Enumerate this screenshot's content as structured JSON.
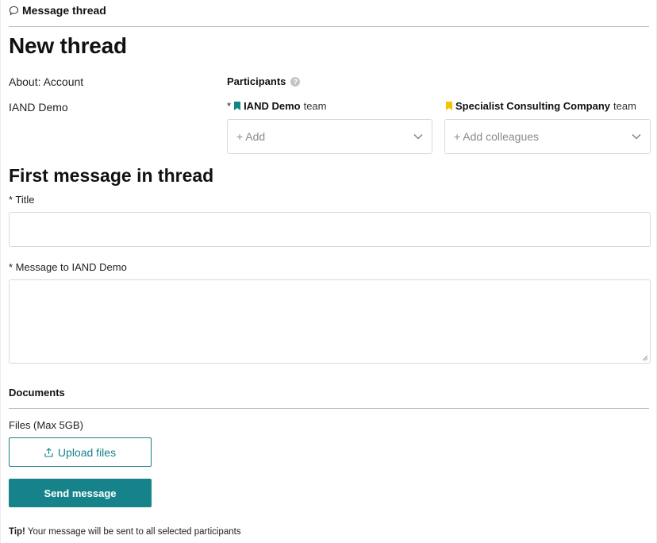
{
  "header": {
    "title": "Message thread",
    "icon": "speech-bubble-icon"
  },
  "page": {
    "heading": "New thread"
  },
  "about": {
    "label": "About: Account",
    "name": "IAND Demo"
  },
  "participants": {
    "label": "Participants",
    "teams": [
      {
        "required": "*",
        "name": "IAND Demo",
        "suffix": "team",
        "flag_color": "#14838a",
        "placeholder": "+ Add"
      },
      {
        "required": "",
        "name": "Specialist Consulting Company",
        "suffix": "team",
        "flag_color": "#f5c400",
        "placeholder": "+ Add colleagues"
      }
    ]
  },
  "first_message": {
    "heading": "First message in thread",
    "title_label": "* Title",
    "title_value": "",
    "message_label": "* Message to IAND Demo",
    "message_value": ""
  },
  "documents": {
    "heading": "Documents",
    "files_label": "Files (Max 5GB)",
    "upload_label": "Upload files"
  },
  "actions": {
    "send_label": "Send message"
  },
  "tip": {
    "prefix": "Tip!",
    "text": "Your message will be sent to all selected participants"
  },
  "colors": {
    "accent": "#16838a",
    "border": "#d9d9d9",
    "divider": "#bdbdbd"
  }
}
